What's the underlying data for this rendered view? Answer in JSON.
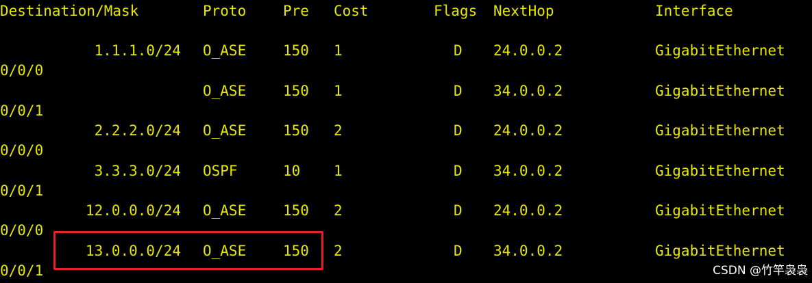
{
  "headers": {
    "destination": "Destination/Mask",
    "proto": "Proto",
    "pre": "Pre",
    "cost": "Cost",
    "flags": "Flags",
    "nexthop": "NextHop",
    "interface": "Interface"
  },
  "routes": [
    {
      "destination": "1.1.1.0/24",
      "proto": "O_ASE",
      "pre": "150",
      "cost": "1",
      "flags": "D",
      "nexthop": "24.0.0.2",
      "interface": "GigabitEthernet",
      "interface_cont": "0/0/0"
    },
    {
      "destination": "",
      "proto": "O_ASE",
      "pre": "150",
      "cost": "1",
      "flags": "D",
      "nexthop": "34.0.0.2",
      "interface": "GigabitEthernet",
      "interface_cont": "0/0/1"
    },
    {
      "destination": "2.2.2.0/24",
      "proto": "O_ASE",
      "pre": "150",
      "cost": "2",
      "flags": "D",
      "nexthop": "24.0.0.2",
      "interface": "GigabitEthernet",
      "interface_cont": "0/0/0"
    },
    {
      "destination": "3.3.3.0/24",
      "proto": "OSPF",
      "pre": "10",
      "cost": "1",
      "flags": "D",
      "nexthop": "34.0.0.2",
      "interface": "GigabitEthernet",
      "interface_cont": "0/0/1"
    },
    {
      "destination": "12.0.0.0/24",
      "proto": "O_ASE",
      "pre": "150",
      "cost": "2",
      "flags": "D",
      "nexthop": "24.0.0.2",
      "interface": "GigabitEthernet",
      "interface_cont": "0/0/0"
    },
    {
      "destination": "13.0.0.0/24",
      "proto": "O_ASE",
      "pre": "150",
      "cost": "2",
      "flags": "D",
      "nexthop": "34.0.0.2",
      "interface": "GigabitEthernet",
      "interface_cont": "0/0/1"
    }
  ],
  "watermark": "CSDN @竹竿袅袅",
  "colors": {
    "text": "#e6e600",
    "background": "#000000",
    "highlight": "#e8202a"
  }
}
